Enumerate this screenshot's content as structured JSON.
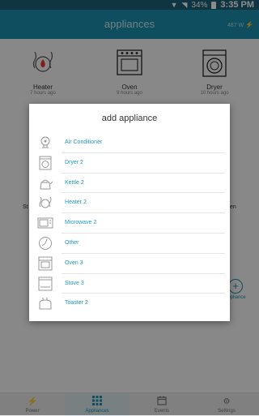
{
  "status_bar": {
    "battery": "34%",
    "time": "3:35 PM"
  },
  "app_bar": {
    "title": "appliances",
    "power": "487 W"
  },
  "appliances": [
    {
      "name": "Heater",
      "time": "7 hours ago"
    },
    {
      "name": "Oven",
      "time": "9 hours ago"
    },
    {
      "name": "Dryer",
      "time": "10 hours ago"
    }
  ],
  "background_fragments": {
    "left_label": "St",
    "right_label": "en",
    "add_label": "appliance"
  },
  "dialog": {
    "title": "add appliance",
    "items": [
      {
        "label": "Air Conditioner",
        "icon": "air-conditioner-icon"
      },
      {
        "label": "Dryer 2",
        "icon": "dryer-icon"
      },
      {
        "label": "Kettle 2",
        "icon": "kettle-icon"
      },
      {
        "label": "Heater 2",
        "icon": "heater-icon"
      },
      {
        "label": "Microwave 2",
        "icon": "microwave-icon"
      },
      {
        "label": "Other",
        "icon": "other-icon"
      },
      {
        "label": "Oven 3",
        "icon": "oven-icon"
      },
      {
        "label": "Stove 3",
        "icon": "stove-icon"
      },
      {
        "label": "Toaster 2",
        "icon": "toaster-icon"
      }
    ]
  },
  "bottom_nav": [
    {
      "label": "Power",
      "icon": "lightning-icon"
    },
    {
      "label": "Appliances",
      "icon": "grid-icon",
      "active": true
    },
    {
      "label": "Events",
      "icon": "calendar-icon"
    },
    {
      "label": "Settings",
      "icon": "gear-icon"
    }
  ],
  "colors": {
    "accent": "#1b8fae",
    "status_bar": "#1d5f79",
    "link": "#1b9ac2",
    "power_bolt": "#e53935"
  }
}
